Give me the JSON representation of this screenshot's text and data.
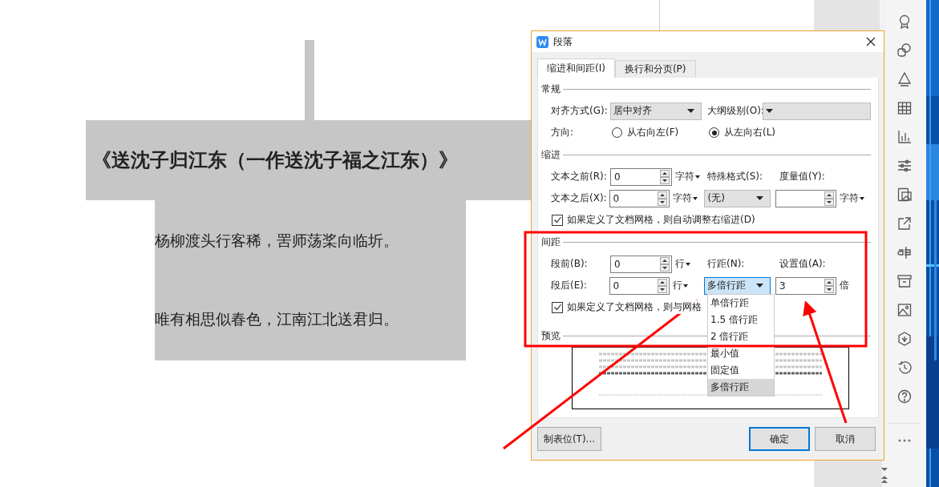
{
  "document": {
    "title": "《送沈子归江东（一作送沈子福之江东）》",
    "lines": [
      "杨柳渡头行客稀，罟师荡桨向临圻。",
      "唯有相思似春色，江南江北送君归。"
    ]
  },
  "dialog": {
    "title": "段落",
    "tabs": [
      {
        "label": "缩进和间距(I)",
        "selected": true
      },
      {
        "label": "换行和分页(P)",
        "selected": false
      }
    ],
    "general": {
      "heading": "常规",
      "alignment": {
        "label": "对齐方式(G):",
        "value": "居中对齐"
      },
      "outline_level": {
        "label": "大纲级别(O):"
      },
      "direction": {
        "label": "方向:",
        "options": [
          {
            "label": "从右向左(F)",
            "selected": false
          },
          {
            "label": "从左向右(L)",
            "selected": true
          }
        ]
      }
    },
    "indent": {
      "heading": "缩进",
      "before": {
        "label": "文本之前(R):",
        "value": "0",
        "unit": "字符"
      },
      "after": {
        "label": "文本之后(X):",
        "value": "0",
        "unit": "字符"
      },
      "special": {
        "label": "特殊格式(S):",
        "value": "(无)"
      },
      "measure": {
        "label": "度量值(Y):",
        "unit": "字符"
      },
      "grid_checkbox": {
        "label": "如果定义了文档网格，则自动调整右缩进(D)",
        "checked": true
      }
    },
    "spacing": {
      "heading": "间距",
      "before": {
        "label": "段前(B):",
        "value": "0",
        "unit": "行"
      },
      "after": {
        "label": "段后(E):",
        "value": "0",
        "unit": "行"
      },
      "line_spacing": {
        "label": "行距(N):",
        "value": "多倍行距",
        "expanded": true,
        "options": [
          {
            "label": "单倍行距",
            "selected": false
          },
          {
            "label": "1.5 倍行距",
            "selected": false
          },
          {
            "label": "2 倍行距",
            "selected": false
          },
          {
            "label": "最小值",
            "selected": false
          },
          {
            "label": "固定值",
            "selected": false
          },
          {
            "label": "多倍行距",
            "selected": true
          }
        ]
      },
      "setting": {
        "label": "设置值(A):",
        "value": "3",
        "unit": "倍"
      },
      "grid_checkbox": {
        "label": "如果定义了文档网格，则与网格",
        "checked": true
      }
    },
    "preview": {
      "heading": "预览"
    },
    "buttons": [
      {
        "label": "制表位(T)...",
        "default": false
      },
      {
        "label": "确定",
        "default": true
      },
      {
        "label": "取消",
        "default": false
      }
    ]
  }
}
